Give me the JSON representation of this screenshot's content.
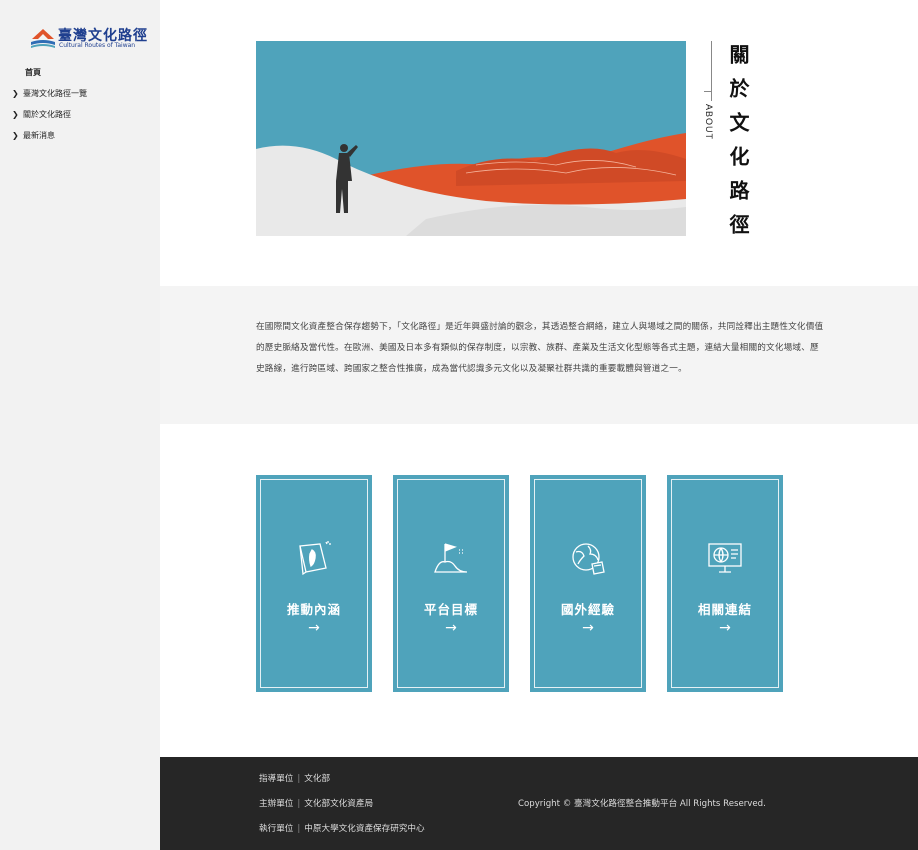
{
  "logo": {
    "title": "臺灣文化路徑",
    "subtitle": "Cultural Routes of Taiwan"
  },
  "nav": {
    "home": "首頁",
    "items": [
      {
        "label": "臺灣文化路徑一覽"
      },
      {
        "label": "關於文化路徑"
      },
      {
        "label": "最新消息"
      }
    ]
  },
  "about": {
    "en": "ABOUT",
    "title": "關於文化路徑"
  },
  "intro": {
    "text": "在國際間文化資產整合保存趨勢下，「文化路徑」是近年興盛討論的觀念，其透過整合網絡，建立人與場域之間的關係，共同詮釋出主題性文化價值的歷史脈絡及當代性。在歐洲、美國及日本多有類似的保存制度，以宗教、族群、產業及生活文化型態等各式主題，連結大量相關的文化場域、歷史路線，進行跨區域、跨國家之整合性推廣，成為當代認識多元文化以及凝聚社群共識的重要載體與管道之一。"
  },
  "cards": [
    {
      "label": "推動內涵",
      "arrow": "→",
      "icon": "book-taiwan-icon"
    },
    {
      "label": "平台目標",
      "arrow": "→",
      "icon": "flag-mountain-icon"
    },
    {
      "label": "國外經驗",
      "arrow": "→",
      "icon": "globe-icon"
    },
    {
      "label": "相關連結",
      "arrow": "→",
      "icon": "monitor-globe-icon"
    }
  ],
  "footer": {
    "rows": [
      {
        "key": "指導單位",
        "sep": "|",
        "value": "文化部"
      },
      {
        "key": "主辦單位",
        "sep": "|",
        "value": "文化部文化資產局"
      },
      {
        "key": "執行單位",
        "sep": "|",
        "value": "中原大學文化資產保存研究中心"
      }
    ],
    "copyright": "Copyright © 臺灣文化路徑整合推動平台 All Rights Reserved."
  },
  "colors": {
    "accent": "#4fa3bb",
    "orange": "#e0532a",
    "sidebar": "#f2f2f2",
    "footer": "#262626"
  }
}
